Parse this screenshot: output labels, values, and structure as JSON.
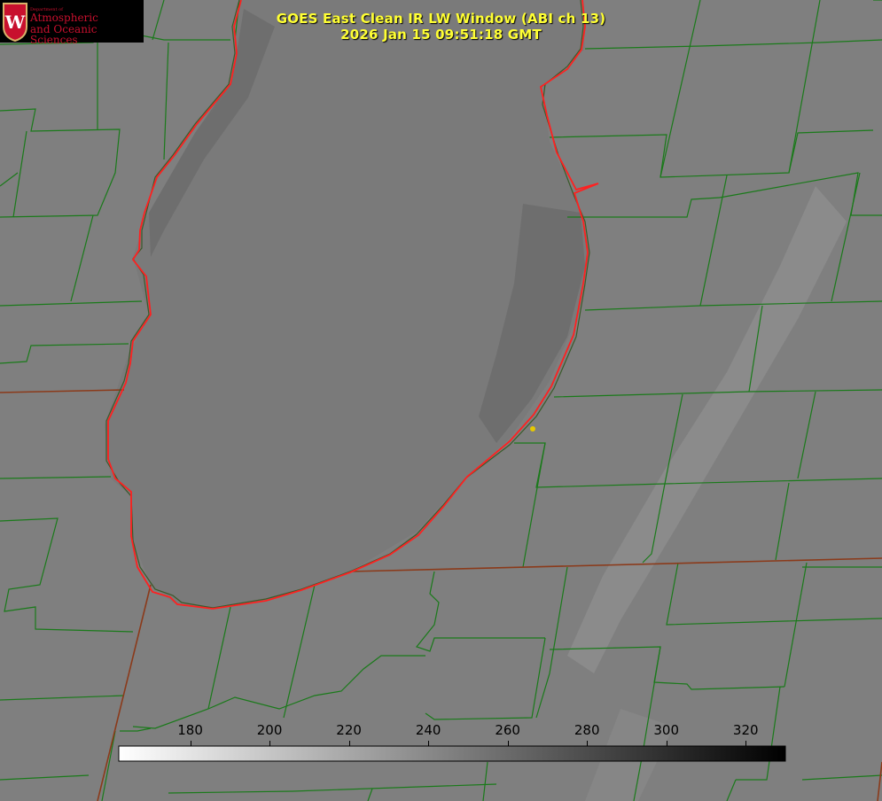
{
  "title": {
    "line1": "GOES East Clean IR LW Window (ABI ch 13)",
    "line2": "2026 Jan 15 09:51:18 GMT"
  },
  "logo": {
    "dept": "Department of",
    "line1": "Atmospheric",
    "line2": "and Oceanic Sciences",
    "initial": "W"
  },
  "colorbar": {
    "min": 162,
    "max": 330,
    "gradient": [
      "#ffffff",
      "#000000"
    ],
    "ticks": [
      {
        "value": 180,
        "label": "180"
      },
      {
        "value": 200,
        "label": "200"
      },
      {
        "value": 220,
        "label": "220"
      },
      {
        "value": 240,
        "label": "240"
      },
      {
        "value": 260,
        "label": "260"
      },
      {
        "value": 280,
        "label": "280"
      },
      {
        "value": 300,
        "label": "300"
      },
      {
        "value": 320,
        "label": "320"
      }
    ]
  },
  "colors": {
    "county_lines": "#1a7a1a",
    "state_lines": "#8b3a1a",
    "shoreline": "#ff2020",
    "marker": "#e6c800",
    "title": "#ffff33",
    "background": "#7d7d7d"
  }
}
